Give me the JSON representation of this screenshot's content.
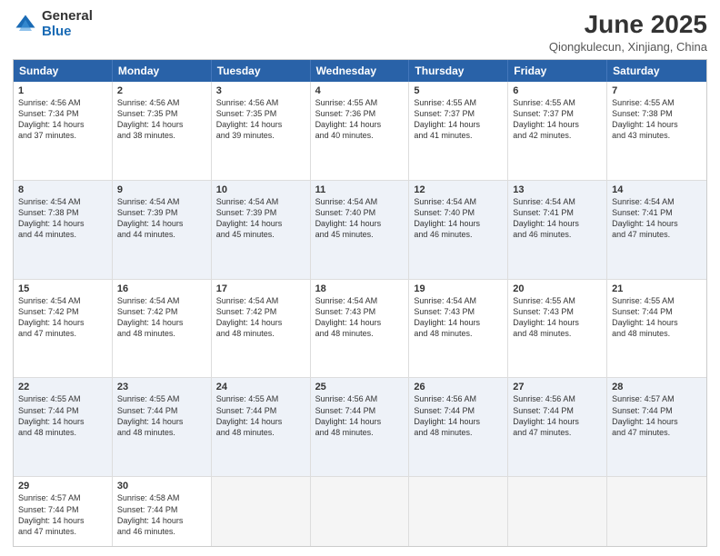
{
  "logo": {
    "general": "General",
    "blue": "Blue"
  },
  "header": {
    "month": "June 2025",
    "location": "Qiongkulecun, Xinjiang, China"
  },
  "weekdays": [
    "Sunday",
    "Monday",
    "Tuesday",
    "Wednesday",
    "Thursday",
    "Friday",
    "Saturday"
  ],
  "rows": [
    [
      {
        "day": "1",
        "lines": [
          "Sunrise: 4:56 AM",
          "Sunset: 7:34 PM",
          "Daylight: 14 hours",
          "and 37 minutes."
        ]
      },
      {
        "day": "2",
        "lines": [
          "Sunrise: 4:56 AM",
          "Sunset: 7:35 PM",
          "Daylight: 14 hours",
          "and 38 minutes."
        ]
      },
      {
        "day": "3",
        "lines": [
          "Sunrise: 4:56 AM",
          "Sunset: 7:35 PM",
          "Daylight: 14 hours",
          "and 39 minutes."
        ]
      },
      {
        "day": "4",
        "lines": [
          "Sunrise: 4:55 AM",
          "Sunset: 7:36 PM",
          "Daylight: 14 hours",
          "and 40 minutes."
        ]
      },
      {
        "day": "5",
        "lines": [
          "Sunrise: 4:55 AM",
          "Sunset: 7:37 PM",
          "Daylight: 14 hours",
          "and 41 minutes."
        ]
      },
      {
        "day": "6",
        "lines": [
          "Sunrise: 4:55 AM",
          "Sunset: 7:37 PM",
          "Daylight: 14 hours",
          "and 42 minutes."
        ]
      },
      {
        "day": "7",
        "lines": [
          "Sunrise: 4:55 AM",
          "Sunset: 7:38 PM",
          "Daylight: 14 hours",
          "and 43 minutes."
        ]
      }
    ],
    [
      {
        "day": "8",
        "lines": [
          "Sunrise: 4:54 AM",
          "Sunset: 7:38 PM",
          "Daylight: 14 hours",
          "and 44 minutes."
        ]
      },
      {
        "day": "9",
        "lines": [
          "Sunrise: 4:54 AM",
          "Sunset: 7:39 PM",
          "Daylight: 14 hours",
          "and 44 minutes."
        ]
      },
      {
        "day": "10",
        "lines": [
          "Sunrise: 4:54 AM",
          "Sunset: 7:39 PM",
          "Daylight: 14 hours",
          "and 45 minutes."
        ]
      },
      {
        "day": "11",
        "lines": [
          "Sunrise: 4:54 AM",
          "Sunset: 7:40 PM",
          "Daylight: 14 hours",
          "and 45 minutes."
        ]
      },
      {
        "day": "12",
        "lines": [
          "Sunrise: 4:54 AM",
          "Sunset: 7:40 PM",
          "Daylight: 14 hours",
          "and 46 minutes."
        ]
      },
      {
        "day": "13",
        "lines": [
          "Sunrise: 4:54 AM",
          "Sunset: 7:41 PM",
          "Daylight: 14 hours",
          "and 46 minutes."
        ]
      },
      {
        "day": "14",
        "lines": [
          "Sunrise: 4:54 AM",
          "Sunset: 7:41 PM",
          "Daylight: 14 hours",
          "and 47 minutes."
        ]
      }
    ],
    [
      {
        "day": "15",
        "lines": [
          "Sunrise: 4:54 AM",
          "Sunset: 7:42 PM",
          "Daylight: 14 hours",
          "and 47 minutes."
        ]
      },
      {
        "day": "16",
        "lines": [
          "Sunrise: 4:54 AM",
          "Sunset: 7:42 PM",
          "Daylight: 14 hours",
          "and 48 minutes."
        ]
      },
      {
        "day": "17",
        "lines": [
          "Sunrise: 4:54 AM",
          "Sunset: 7:42 PM",
          "Daylight: 14 hours",
          "and 48 minutes."
        ]
      },
      {
        "day": "18",
        "lines": [
          "Sunrise: 4:54 AM",
          "Sunset: 7:43 PM",
          "Daylight: 14 hours",
          "and 48 minutes."
        ]
      },
      {
        "day": "19",
        "lines": [
          "Sunrise: 4:54 AM",
          "Sunset: 7:43 PM",
          "Daylight: 14 hours",
          "and 48 minutes."
        ]
      },
      {
        "day": "20",
        "lines": [
          "Sunrise: 4:55 AM",
          "Sunset: 7:43 PM",
          "Daylight: 14 hours",
          "and 48 minutes."
        ]
      },
      {
        "day": "21",
        "lines": [
          "Sunrise: 4:55 AM",
          "Sunset: 7:44 PM",
          "Daylight: 14 hours",
          "and 48 minutes."
        ]
      }
    ],
    [
      {
        "day": "22",
        "lines": [
          "Sunrise: 4:55 AM",
          "Sunset: 7:44 PM",
          "Daylight: 14 hours",
          "and 48 minutes."
        ]
      },
      {
        "day": "23",
        "lines": [
          "Sunrise: 4:55 AM",
          "Sunset: 7:44 PM",
          "Daylight: 14 hours",
          "and 48 minutes."
        ]
      },
      {
        "day": "24",
        "lines": [
          "Sunrise: 4:55 AM",
          "Sunset: 7:44 PM",
          "Daylight: 14 hours",
          "and 48 minutes."
        ]
      },
      {
        "day": "25",
        "lines": [
          "Sunrise: 4:56 AM",
          "Sunset: 7:44 PM",
          "Daylight: 14 hours",
          "and 48 minutes."
        ]
      },
      {
        "day": "26",
        "lines": [
          "Sunrise: 4:56 AM",
          "Sunset: 7:44 PM",
          "Daylight: 14 hours",
          "and 48 minutes."
        ]
      },
      {
        "day": "27",
        "lines": [
          "Sunrise: 4:56 AM",
          "Sunset: 7:44 PM",
          "Daylight: 14 hours",
          "and 47 minutes."
        ]
      },
      {
        "day": "28",
        "lines": [
          "Sunrise: 4:57 AM",
          "Sunset: 7:44 PM",
          "Daylight: 14 hours",
          "and 47 minutes."
        ]
      }
    ],
    [
      {
        "day": "29",
        "lines": [
          "Sunrise: 4:57 AM",
          "Sunset: 7:44 PM",
          "Daylight: 14 hours",
          "and 47 minutes."
        ]
      },
      {
        "day": "30",
        "lines": [
          "Sunrise: 4:58 AM",
          "Sunset: 7:44 PM",
          "Daylight: 14 hours",
          "and 46 minutes."
        ]
      },
      {
        "day": "",
        "lines": []
      },
      {
        "day": "",
        "lines": []
      },
      {
        "day": "",
        "lines": []
      },
      {
        "day": "",
        "lines": []
      },
      {
        "day": "",
        "lines": []
      }
    ]
  ]
}
